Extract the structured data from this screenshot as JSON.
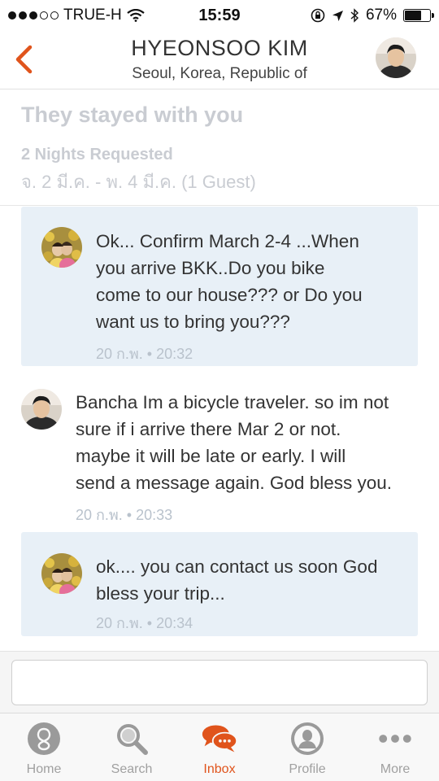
{
  "status_bar": {
    "carrier": "TRUE-H",
    "time": "15:59",
    "battery": "67%",
    "battery_level": 0.67
  },
  "header": {
    "title": "HYEONSOO KIM",
    "subtitle": "Seoul, Korea, Republic of"
  },
  "stay": {
    "title": "They stayed with you",
    "nights": "2 Nights Requested",
    "dates": "จ. 2 มี.ค. - พ. 4 มี.ค. (1 Guest)"
  },
  "messages": [
    {
      "from": "host",
      "lines": [
        "Ok... Confirm March 2-4 ...When",
        "you arrive BKK..Do you bike",
        "come to our house??? or Do you",
        "want us to bring you???"
      ],
      "time": "20 ก.พ. • 20:32"
    },
    {
      "from": "guest",
      "lines": [
        "Bancha Im a bicycle traveler. so im not",
        "sure if i arrive there Mar 2 or not.",
        "maybe it will be late or early. I will",
        "send a message again. God bless you."
      ],
      "time": "20 ก.พ. • 20:33"
    },
    {
      "from": "host",
      "lines": [
        "ok.... you can contact us soon God",
        "bless your trip..."
      ],
      "time": "20 ก.พ. • 20:34"
    }
  ],
  "tabs": [
    {
      "label": "Home",
      "icon": "home-icon"
    },
    {
      "label": "Search",
      "icon": "search-icon"
    },
    {
      "label": "Inbox",
      "icon": "inbox-icon"
    },
    {
      "label": "Profile",
      "icon": "profile-icon"
    },
    {
      "label": "More",
      "icon": "more-icon"
    }
  ],
  "colors": {
    "accent": "#e0541c",
    "host_bubble": "#e8f0f7",
    "muted": "#c9ccd2"
  }
}
